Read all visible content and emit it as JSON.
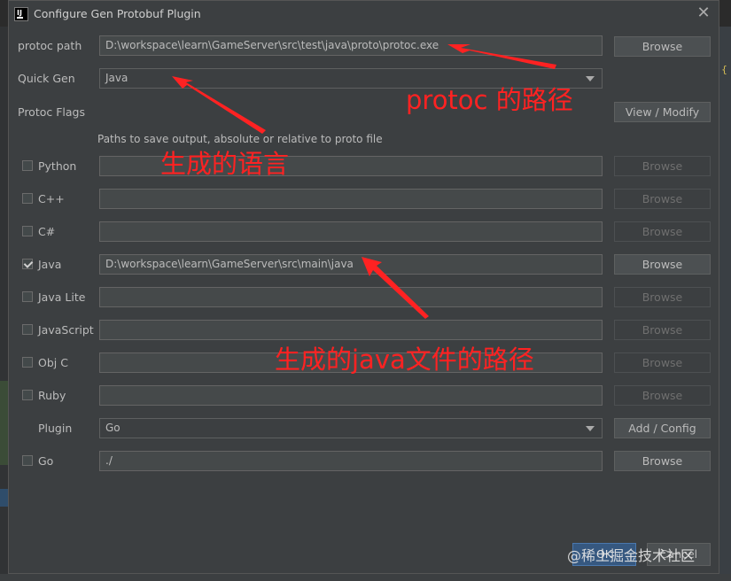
{
  "window": {
    "title": "Configure Gen Protobuf Plugin",
    "close_glyph": "✕"
  },
  "side_glyph": "{",
  "protoc_path": {
    "label": "protoc path",
    "value": "D:\\workspace\\learn\\GameServer\\src\\test\\java\\proto\\protoc.exe",
    "button": "Browse"
  },
  "quick_gen": {
    "label": "Quick Gen",
    "value": "Java"
  },
  "protoc_flags": {
    "label": "Protoc Flags",
    "button": "View / Modify"
  },
  "paths_hint": "Paths to save output, absolute or relative to proto file",
  "languages": [
    {
      "label": "Python",
      "checked": false,
      "value": "",
      "button": "Browse",
      "enabled": false
    },
    {
      "label": "C++",
      "checked": false,
      "value": "",
      "button": "Browse",
      "enabled": false
    },
    {
      "label": "C#",
      "checked": false,
      "value": "",
      "button": "Browse",
      "enabled": false
    },
    {
      "label": "Java",
      "checked": true,
      "value": "D:\\workspace\\learn\\GameServer\\src\\main\\java",
      "button": "Browse",
      "enabled": true
    },
    {
      "label": "Java Lite",
      "checked": false,
      "value": "",
      "button": "Browse",
      "enabled": false
    },
    {
      "label": "JavaScript",
      "checked": false,
      "value": "",
      "button": "Browse",
      "enabled": false
    },
    {
      "label": "Obj C",
      "checked": false,
      "value": "",
      "button": "Browse",
      "enabled": false
    },
    {
      "label": "Ruby",
      "checked": false,
      "value": "",
      "button": "Browse",
      "enabled": false
    }
  ],
  "plugin": {
    "label": "Plugin",
    "value": "Go",
    "button": "Add / Config"
  },
  "go": {
    "label": "Go",
    "checked": false,
    "value": "./",
    "button": "Browse"
  },
  "footer": {
    "ok": "OK",
    "cancel": "Cancel"
  },
  "annotations": {
    "protoc_path_note": "protoc 的路径",
    "language_note": "生成的语言",
    "java_path_note": "生成的java文件的路径"
  },
  "watermark": "@稀土掘金技术社区",
  "colors": {
    "annotation": "#ff2222",
    "dialog_bg": "#3c3f41",
    "primary_button": "#365880"
  }
}
